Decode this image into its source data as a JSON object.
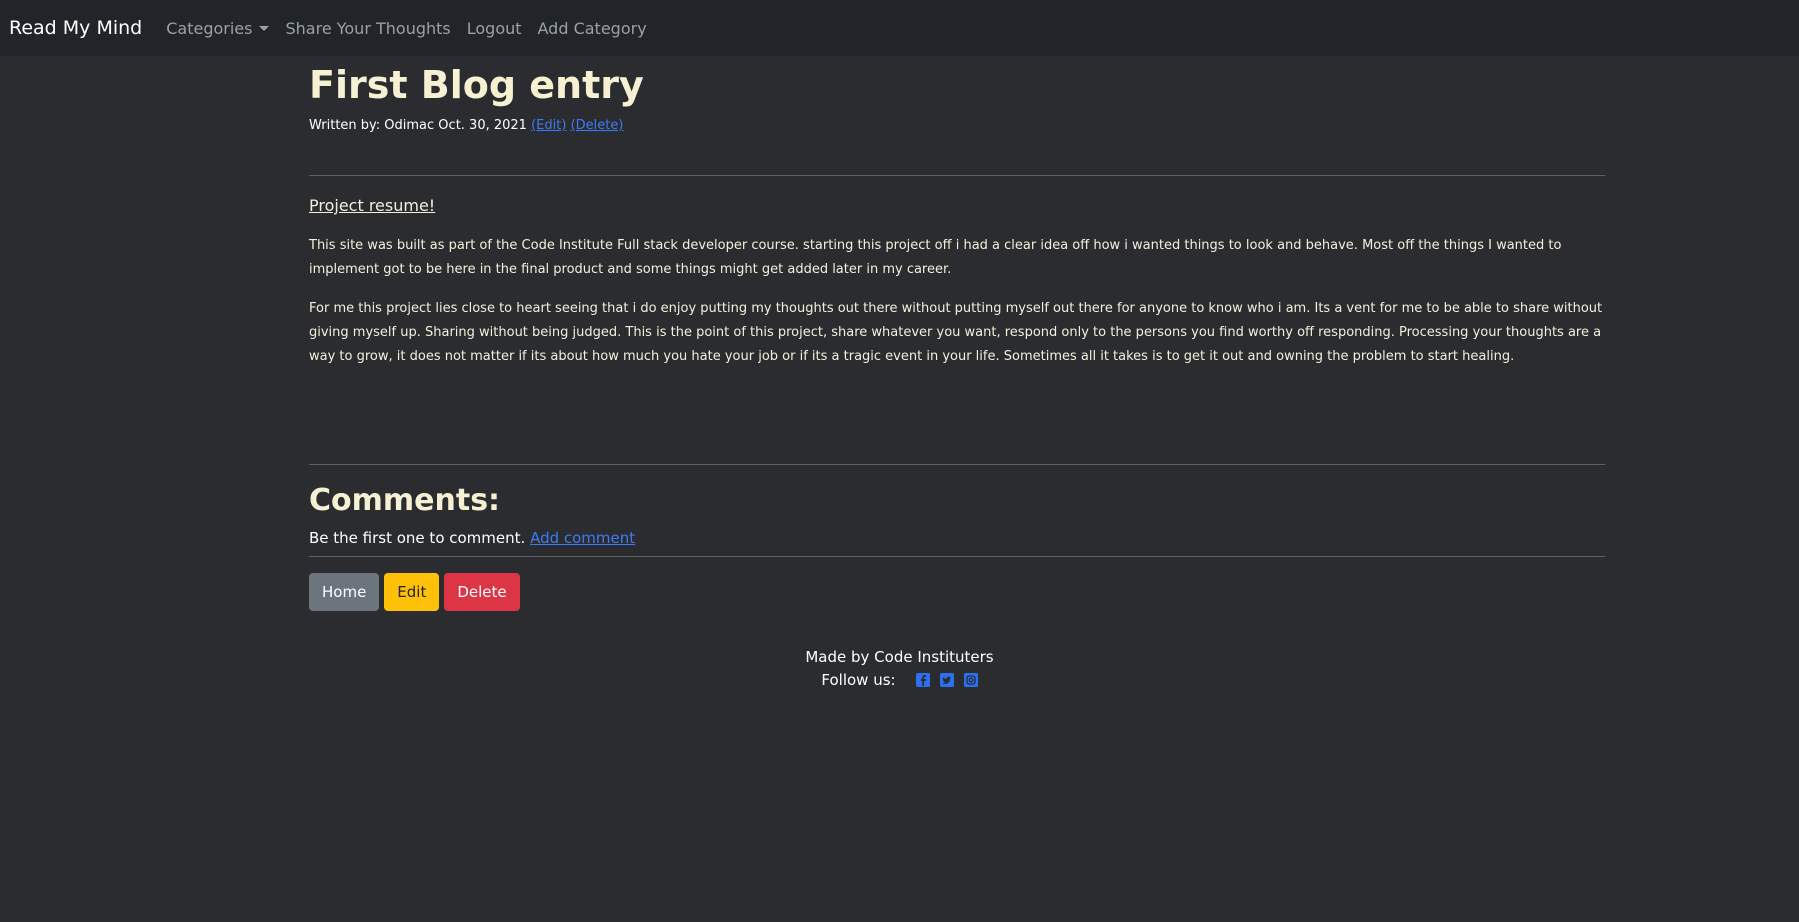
{
  "nav": {
    "brand": "Read My Mind",
    "items": [
      {
        "label": "Categories"
      },
      {
        "label": "Share Your Thoughts"
      },
      {
        "label": "Logout"
      },
      {
        "label": "Add Category"
      }
    ]
  },
  "post": {
    "title": "First Blog entry",
    "byline": "Written by: Odimac Oct. 30, 2021",
    "edit_link": "(Edit)",
    "delete_link": "(Delete)",
    "subtitle": "Project resume!",
    "paragraphs": [
      "This site was built as part of the Code Institute Full stack developer course. starting this project off i had a clear idea off how i wanted things to look and behave. Most off the things I wanted to implement got to be here in the final product and some things might get added later in my career.",
      "For me this project lies close to heart seeing that i do enjoy putting my thoughts out there without putting myself out there for anyone to know who i am. Its a vent for me to be able to share without giving myself up. Sharing without being judged. This is the point of this project, share whatever you want, respond only to the persons you find worthy off responding. Processing your thoughts are a way to grow, it does not matter if its about how much you hate your job or if its a tragic event in your life. Sometimes all it takes is to get it out and owning the problem to start healing."
    ]
  },
  "comments": {
    "heading": "Comments:",
    "empty_text": "Be the first one to comment.",
    "add_link": "Add comment"
  },
  "buttons": {
    "home": "Home",
    "edit": "Edit",
    "delete": "Delete"
  },
  "footer": {
    "made_by": "Made by Code Instituters",
    "follow": "Follow us:",
    "icons": [
      "facebook-icon",
      "twitter-icon",
      "instagram-icon"
    ],
    "icon_color": "#2c6ff0"
  },
  "colors": {
    "background": "#2b2c2f",
    "navbar": "#212529",
    "link": "#3d7bf6"
  }
}
